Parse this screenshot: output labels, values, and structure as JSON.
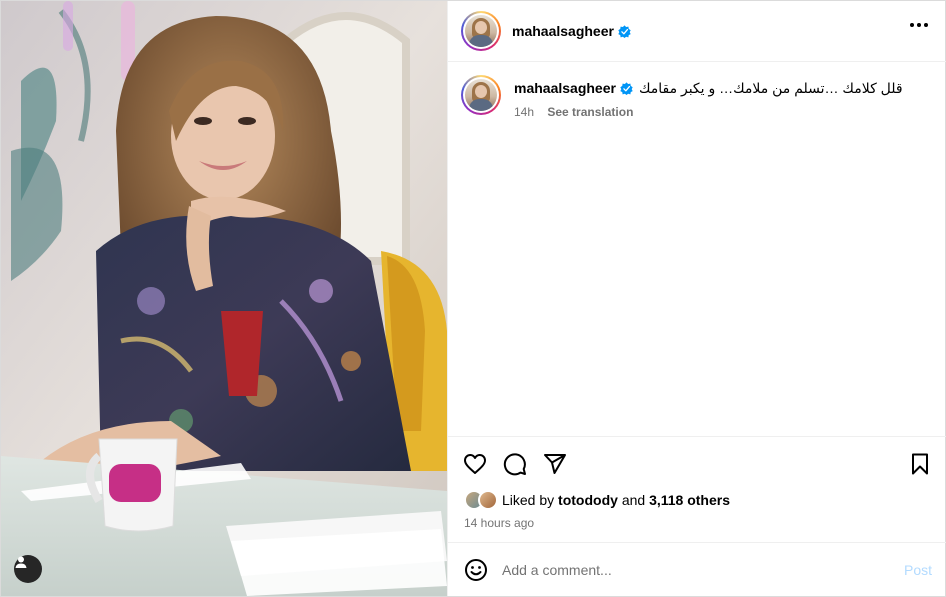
{
  "post": {
    "username": "mahaalsagheer",
    "verified": true
  },
  "caption": {
    "username": "mahaalsagheer",
    "text": "قلل كلامك …تسلم من ملامك… و يكبر مقامك",
    "age": "14h",
    "see_translation": "See translation"
  },
  "likes": {
    "liked_by_label": "Liked by",
    "liker": "totodody",
    "and_label": "and",
    "others": "3,118 others"
  },
  "timestamp": "14 hours ago",
  "comment": {
    "placeholder": "Add a comment...",
    "post_label": "Post"
  },
  "colors": {
    "verified_blue": "#0095f6",
    "post_button_disabled": "#b3dbff",
    "muted_text": "#737373",
    "divider": "#efefef"
  },
  "icons": {
    "more": "more-horizontal-icon",
    "like": "heart-icon",
    "comment": "comment-bubble-icon",
    "share": "paper-plane-icon",
    "save": "bookmark-icon",
    "emoji": "emoji-smile-icon",
    "tag": "user-tag-icon",
    "verified": "verified-badge-icon"
  }
}
